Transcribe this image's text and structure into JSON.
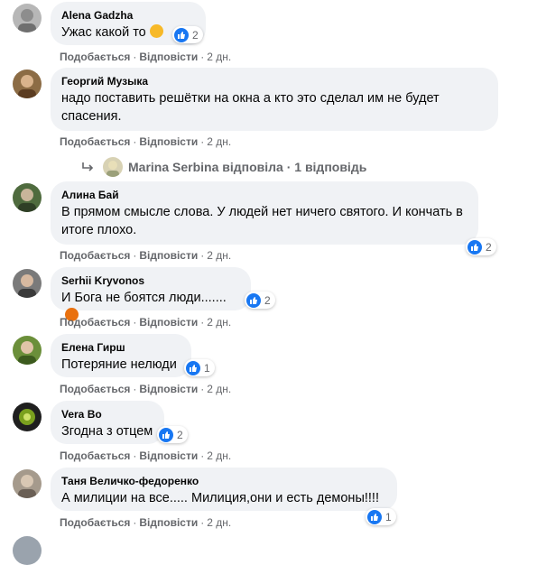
{
  "comments": [
    {
      "author": "Alena Gadzha",
      "text": "Ужас какой то",
      "likes": "2",
      "like": "Подобається",
      "reply": "Відповісти",
      "time": "2 дн.",
      "emoji": "sad-emoji"
    },
    {
      "author": "Георгий Музыка",
      "text": "надо поставить решётки на окна а кто это сделал им не будет спасения.",
      "likes": "",
      "like": "Подобається",
      "reply": "Відповісти",
      "time": "2 дн."
    },
    {
      "author": "Алина Бай",
      "text": "В прямом смысле слова. У людей нет ничего святого. И кончать в итоге плохо.",
      "likes": "2",
      "like": "Подобається",
      "reply": "Відповісти",
      "time": "2 дн."
    },
    {
      "author": "Serhii Kryvonos",
      "text": "И Бога не боятся люди.......",
      "likes": "2",
      "like": "Подобається",
      "reply": "Відповісти",
      "time": "2 дн.",
      "emoji": "angry-emoji"
    },
    {
      "author": "Елена Гирш",
      "text": "Потеряние нелюди",
      "likes": "1",
      "like": "Подобається",
      "reply": "Відповісти",
      "time": "2 дн."
    },
    {
      "author": "Vera Bo",
      "text": "Згодна з отцем",
      "likes": "2",
      "like": "Подобається",
      "reply": "Відповісти",
      "time": "2 дн."
    },
    {
      "author": "Таня Величко-федоренко",
      "text": "А милиции на все..... Милиция,они и есть демоны!!!!",
      "likes": "1",
      "like": "Подобається",
      "reply": "Відповісти",
      "time": "2 дн."
    }
  ],
  "replies_link": {
    "text": "Marina Serbina відповіла · 1 відповідь"
  },
  "separator": "·",
  "colors": {
    "bubble": "#f0f2f5",
    "like_blue": "#1877f2",
    "meta": "#65676b"
  }
}
